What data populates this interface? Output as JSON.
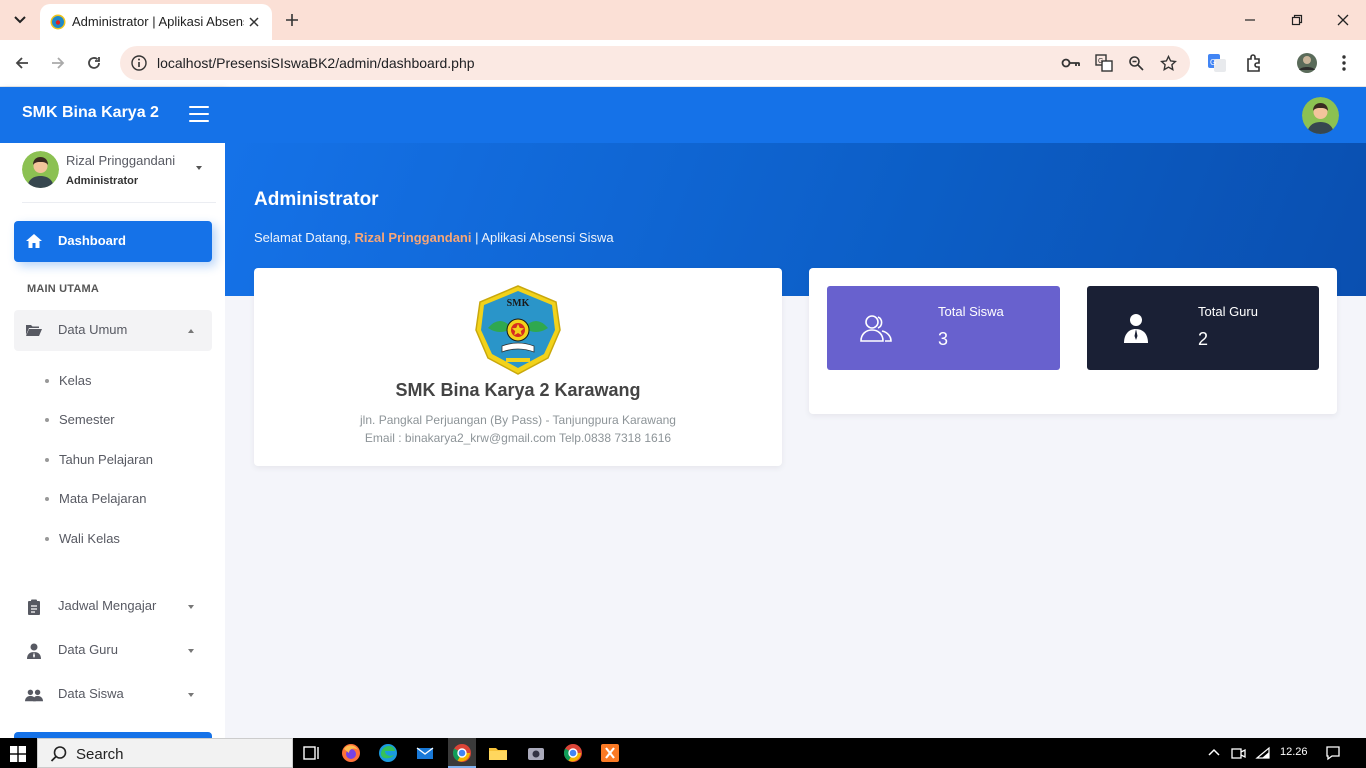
{
  "browser": {
    "tab_title": "Administrator | Aplikasi Absensi",
    "url": "localhost/PresensiSIswaBK2/admin/dashboard.php",
    "icons": [
      "tab-search-icon",
      "favicon-icon",
      "close-icon",
      "plus-icon",
      "minimize-icon",
      "restore-icon",
      "close-window-icon",
      "back-icon",
      "forward-icon",
      "reload-icon",
      "site-info-icon",
      "key-icon",
      "translate-icon",
      "zoom-icon",
      "star-icon",
      "google-translate-icon",
      "extensions-icon",
      "profile-icon",
      "menu-icon"
    ]
  },
  "app": {
    "brand": "SMK Bina Karya 2",
    "colors": {
      "primary": "#1572e8",
      "stat_students": "#6861ce",
      "stat_teachers": "#1a2035",
      "highlight": "#f7a677"
    }
  },
  "sidebar": {
    "user": {
      "name": "Rizal Pringgandani",
      "role": "Administrator"
    },
    "active_item": {
      "label": "Dashboard",
      "icon": "home-icon"
    },
    "section_title": "MAIN UTAMA",
    "data_umum": {
      "label": "Data Umum",
      "icon": "folder-open-icon",
      "children": [
        "Kelas",
        "Semester",
        "Tahun Pelajaran",
        "Mata Pelajaran",
        "Wali Kelas"
      ]
    },
    "items": [
      {
        "label": "Jadwal Mengajar",
        "icon": "clipboard-icon"
      },
      {
        "label": "Data Guru",
        "icon": "user-tie-icon"
      },
      {
        "label": "Data Siswa",
        "icon": "users-icon"
      }
    ]
  },
  "main": {
    "page_title": "Administrator",
    "welcome_prefix": "Selamat Datang,",
    "welcome_name": "Rizal Pringgandani",
    "welcome_suffix": "| Aplikasi Absensi Siswa",
    "school": {
      "logo_text": "SMK",
      "name": "SMK Bina Karya 2 Karawang",
      "address": "jln. Pangkal Perjuangan (By Pass) - Tanjungpura Karawang",
      "contact": "Email : binakarya2_krw@gmail.com Telp.0838 7318 1616"
    },
    "stats": [
      {
        "label": "Total Siswa",
        "value": "3",
        "icon": "users-outline-icon"
      },
      {
        "label": "Total Guru",
        "value": "2",
        "icon": "user-tie-icon"
      }
    ]
  },
  "taskbar": {
    "search_label": "Search",
    "time": "12.26"
  }
}
